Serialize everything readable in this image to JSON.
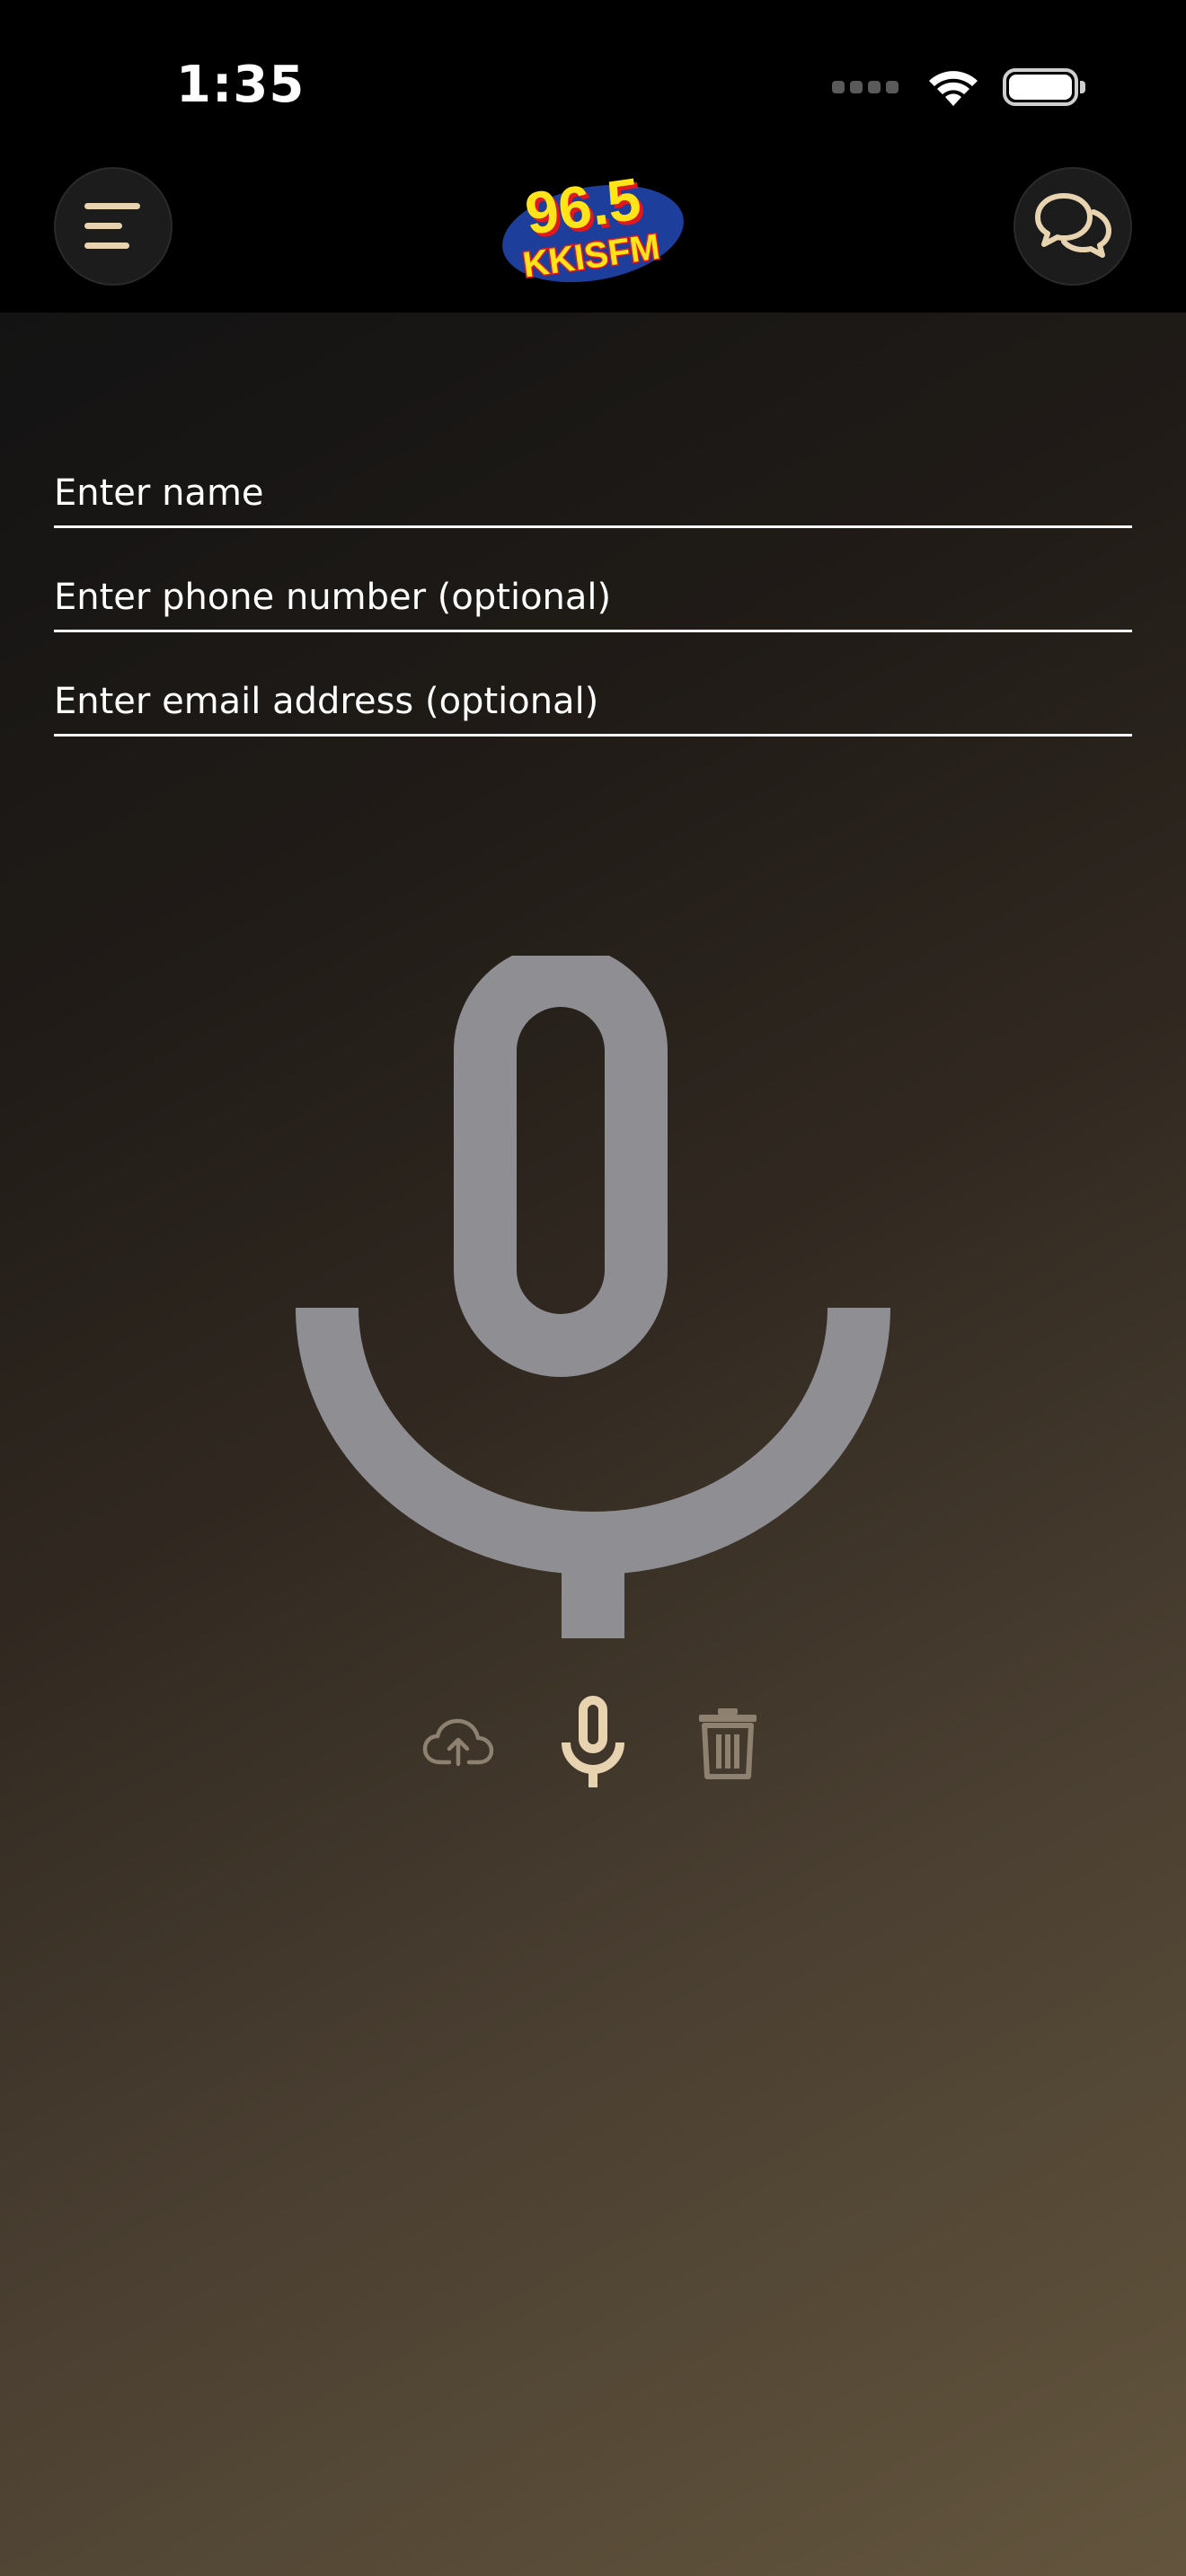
{
  "status_bar": {
    "time": "1:35"
  },
  "header": {
    "logo": {
      "line1": "96.5",
      "line2": "KKISFM"
    },
    "menu_icon": "menu-lines-icon",
    "chat_icon": "chat-bubbles-icon"
  },
  "form": {
    "name": {
      "placeholder": "Enter name",
      "value": ""
    },
    "phone": {
      "placeholder": "Enter phone number (optional)",
      "value": ""
    },
    "email": {
      "placeholder": "Enter email address (optional)",
      "value": ""
    }
  },
  "recorder": {
    "main_icon": "microphone-icon",
    "controls": [
      {
        "icon": "cloud-upload-icon"
      },
      {
        "icon": "microphone-icon"
      },
      {
        "icon": "trash-icon"
      }
    ]
  },
  "colors": {
    "accent": "#e8d3b0",
    "muted_control": "#8e8170",
    "big_mic": "#8e8e93",
    "logo_yellow": "#ffe419",
    "logo_red": "#e0191f",
    "logo_blue": "#1d3e9a"
  }
}
